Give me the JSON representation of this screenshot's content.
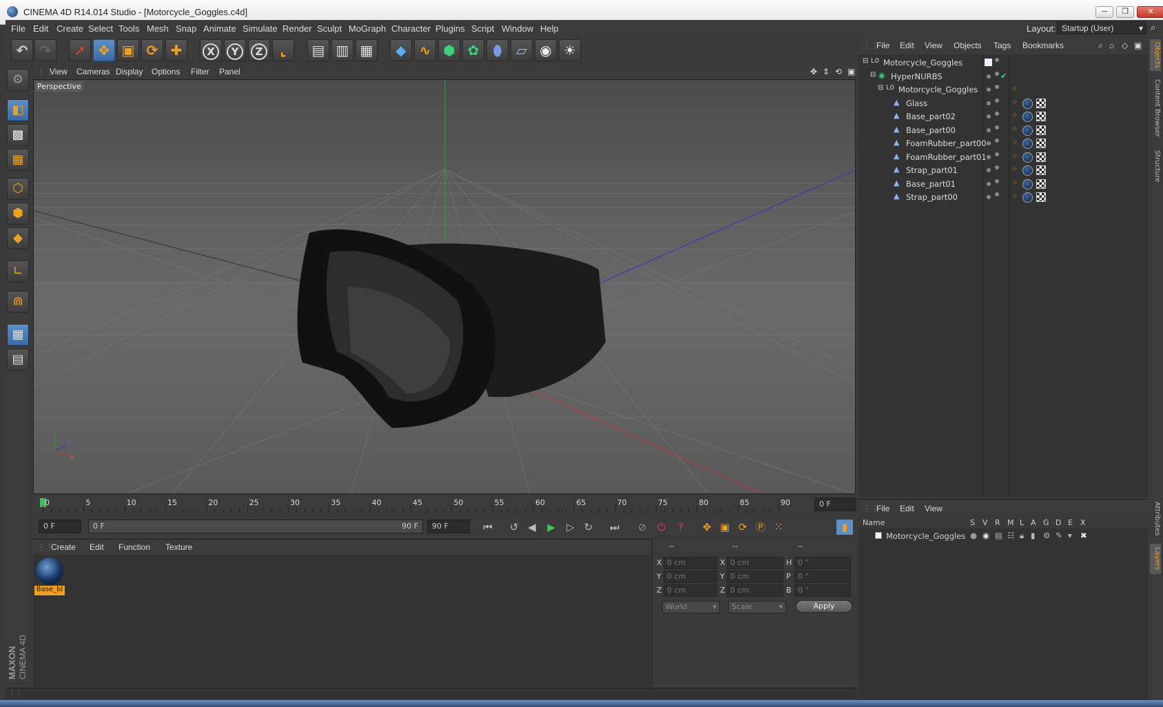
{
  "window": {
    "title": "CINEMA 4D R14.014 Studio - [Motorcycle_Goggles.c4d]",
    "min": "─",
    "max": "❐",
    "close": "✕"
  },
  "menubar": {
    "items": [
      "File",
      "Edit",
      "Create",
      "Select",
      "Tools",
      "Mesh",
      "Snap",
      "Animate",
      "Simulate",
      "Render",
      "Sculpt",
      "MoGraph",
      "Character",
      "Plugins",
      "Script",
      "Window",
      "Help"
    ],
    "layout_label": "Layout:",
    "layout_value": "Startup (User)"
  },
  "toolbar": {
    "axis_x": "X",
    "axis_y": "Y",
    "axis_z": "Z"
  },
  "viewport": {
    "menu": [
      "View",
      "Cameras",
      "Display",
      "Options",
      "Filter",
      "Panel"
    ],
    "camera_label": "Perspective",
    "axis_y": "Y",
    "axis_z": "Z",
    "axis_x": "X"
  },
  "timeline": {
    "ticks": [
      "0",
      "5",
      "10",
      "15",
      "20",
      "25",
      "30",
      "35",
      "40",
      "45",
      "50",
      "55",
      "60",
      "65",
      "70",
      "75",
      "80",
      "85",
      "90"
    ],
    "current_frame": "0 F",
    "start_field": "0 F",
    "range_start": "0 F",
    "range_end": "90 F",
    "end_field": "90 F"
  },
  "material_manager": {
    "menu": [
      "Create",
      "Edit",
      "Function",
      "Texture"
    ],
    "material_name": "Base_bl"
  },
  "coordinates": {
    "headers": [
      "--",
      "--",
      "--"
    ],
    "pos": {
      "x": "0 cm",
      "y": "0 cm",
      "z": "0 cm"
    },
    "size": {
      "x": "0 cm",
      "y": "0 cm",
      "z": "0 cm"
    },
    "rot": {
      "h": "0 °",
      "p": "0 °",
      "b": "0 °"
    },
    "labels": {
      "x": "X",
      "y": "Y",
      "z": "Z",
      "h": "H",
      "p": "P",
      "b": "B"
    },
    "mode": "World",
    "scale": "Scale",
    "apply": "Apply"
  },
  "object_manager": {
    "menu": [
      "File",
      "Edit",
      "View",
      "Objects",
      "Tags",
      "Bookmarks"
    ],
    "objects": [
      {
        "name": "Motorcycle_Goggles",
        "indent": 0,
        "tags": false
      },
      {
        "name": "HyperNURBS",
        "indent": 1,
        "tags": false
      },
      {
        "name": "Motorcycle_Goggles",
        "indent": 2,
        "tags": false
      },
      {
        "name": "Glass",
        "indent": 3,
        "tags": true
      },
      {
        "name": "Base_part02",
        "indent": 3,
        "tags": true
      },
      {
        "name": "Base_part00",
        "indent": 3,
        "tags": true
      },
      {
        "name": "FoamRubber_part00",
        "indent": 3,
        "tags": true
      },
      {
        "name": "FoamRubber_part01",
        "indent": 3,
        "tags": true
      },
      {
        "name": "Strap_part01",
        "indent": 3,
        "tags": true
      },
      {
        "name": "Base_part01",
        "indent": 3,
        "tags": true
      },
      {
        "name": "Strap_part00",
        "indent": 3,
        "tags": true
      }
    ]
  },
  "layer_manager": {
    "menu": [
      "File",
      "Edit",
      "View"
    ],
    "columns": [
      "Name",
      "S",
      "V",
      "R",
      "M",
      "L",
      "A",
      "G",
      "D",
      "E",
      "X"
    ],
    "layer_name": "Motorcycle_Goggles"
  },
  "side_tabs": [
    "Objects",
    "Content Browser",
    "Structure",
    "Attributes",
    "Layers"
  ],
  "brand": {
    "maxon": "MAXON",
    "product": "CINEMA 4D"
  },
  "colors": {
    "accent": "#f0a020",
    "selected": "#3b6aa5"
  }
}
